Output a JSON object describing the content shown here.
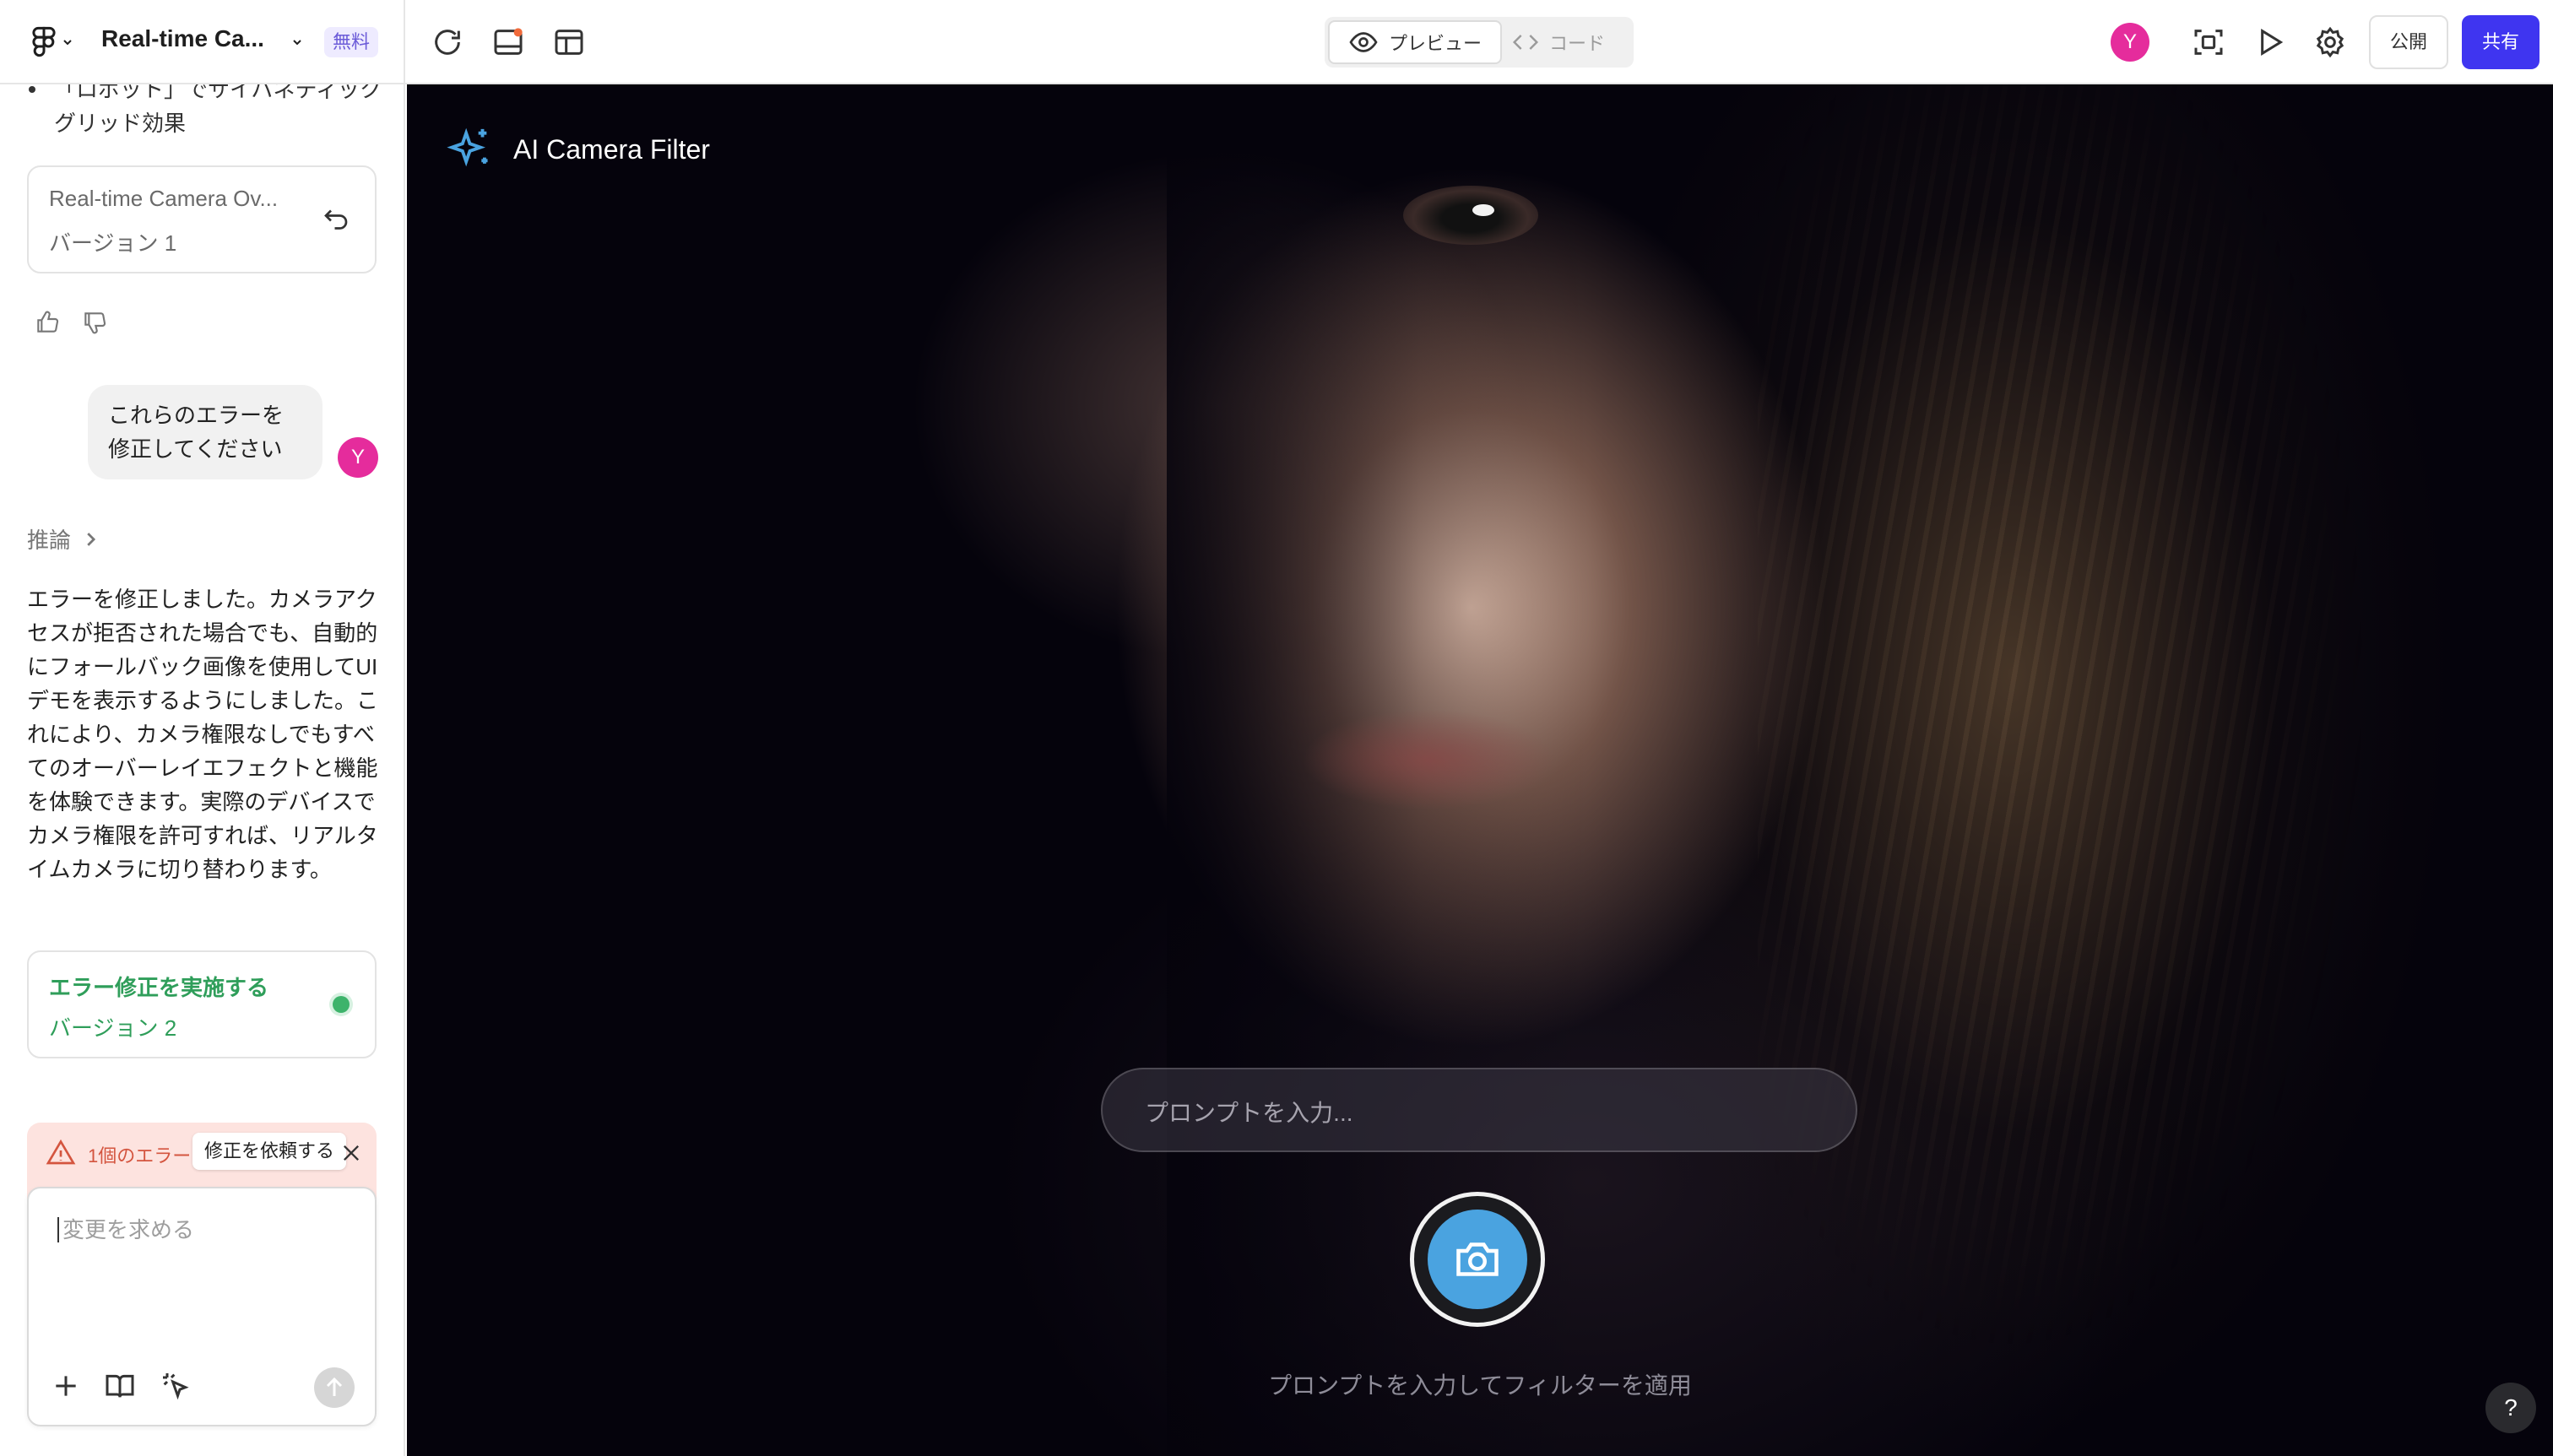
{
  "header": {
    "project_title": "Real-time Ca...",
    "plan_badge": "無料",
    "view_toggle": {
      "preview_label": "プレビュー",
      "code_label": "コード"
    },
    "user_initial": "Y",
    "publish_label": "公開",
    "share_label": "共有"
  },
  "sidebar": {
    "bullet_text": "「ロボット」でサイバネティックグリッド効果",
    "version_card_1": {
      "title": "Real-time Camera Ov...",
      "subtitle": "バージョン 1"
    },
    "user_message": "これらのエラーを修正してください",
    "user_initial": "Y",
    "reasoning_label": "推論",
    "assistant_message": "エラーを修正しました。カメラアクセスが拒否された場合でも、自動的にフォールバック画像を使用してUIデモを表示するようにしました。これにより、カメラ権限なしでもすべてのオーバーレイエフェクトと機能を体験できます。実際のデバイスでカメラ権限を許可すれば、リアルタイムカメラに切り替わります。",
    "version_card_2": {
      "title": "エラー修正を実施する",
      "subtitle": "バージョン 2"
    },
    "error_banner": {
      "text": "1個のエラー",
      "fix_label": "修正を依頼する"
    },
    "chat_input": {
      "placeholder": "変更を求める"
    }
  },
  "preview": {
    "app_title": "AI Camera Filter",
    "prompt_placeholder": "プロンプトを入力...",
    "hint_text": "プロンプトを入力してフィルターを適用",
    "help_label": "?"
  },
  "colors": {
    "accent": "#3f35f0",
    "avatar": "#e52c9c",
    "success": "#2f9e5a",
    "error": "#d4553f",
    "camera_button": "#4aa3e0",
    "sparkle": "#4aa3e0"
  },
  "icons": [
    "figma-icon",
    "chevron-down-icon",
    "refresh-icon",
    "panel-icon",
    "responsive-icon",
    "eye-icon",
    "code-icon",
    "scan-icon",
    "play-icon",
    "gear-icon",
    "undo-icon",
    "thumbs-up-icon",
    "thumbs-down-icon",
    "chevron-right-icon",
    "warning-icon",
    "close-icon",
    "plus-icon",
    "book-icon",
    "pointer-sparkle-icon",
    "send-icon",
    "sparkle-icon",
    "camera-icon"
  ]
}
